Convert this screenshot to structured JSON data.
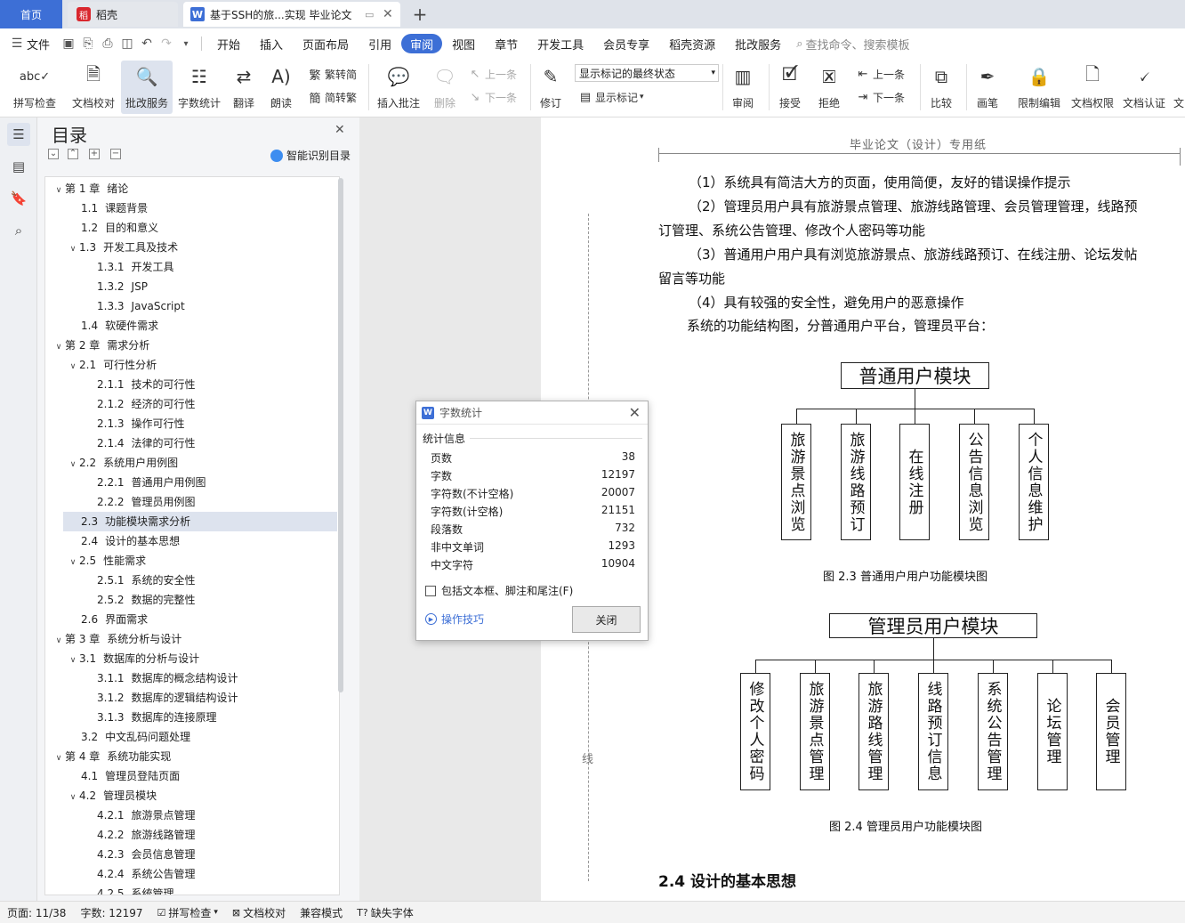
{
  "tabs": {
    "home": "首页",
    "daoke": "稻壳",
    "document": "基于SSH的旅...实现 毕业论文"
  },
  "menu": {
    "file": "文件",
    "items": [
      "开始",
      "插入",
      "页面布局",
      "引用",
      "审阅",
      "视图",
      "章节",
      "开发工具",
      "会员专享",
      "稻壳资源",
      "批改服务"
    ],
    "active_index": 4,
    "search_placeholder": "查找命令、搜索模板"
  },
  "ribbon": {
    "spellcheck": "拼写检查",
    "doc_proof": "文档校对",
    "review_service": "批改服务",
    "word_count": "字数统计",
    "translate": "翻译",
    "read_aloud": "朗读",
    "trad_to_simp": "繁转简",
    "simp_to_trad": "简转繁",
    "insert_comment": "插入批注",
    "delete": "删除",
    "prev_comment": "上一条",
    "next_comment": "下一条",
    "track_changes": "修订",
    "markup_state": "显示标记的最终状态",
    "show_markup": "显示标记",
    "review_pane": "审阅",
    "accept": "接受",
    "reject": "拒绝",
    "prev_change": "上一条",
    "next_change": "下一条",
    "compare": "比较",
    "pen": "画笔",
    "restrict_edit": "限制编辑",
    "doc_permission": "文档权限",
    "doc_certify": "文档认证",
    "more": "文"
  },
  "toc": {
    "title": "目录",
    "smart": "智能识别目录",
    "items": [
      {
        "num": "第 1 章",
        "text": "绪论",
        "level": 0,
        "caret": true
      },
      {
        "num": "1.1",
        "text": "课题背景",
        "level": 1
      },
      {
        "num": "1.2",
        "text": "目的和意义",
        "level": 1
      },
      {
        "num": "1.3",
        "text": "开发工具及技术",
        "level": 1,
        "caret": true
      },
      {
        "num": "1.3.1",
        "text": "开发工具",
        "level": 2
      },
      {
        "num": "1.3.2",
        "text": "JSP",
        "level": 2
      },
      {
        "num": "1.3.3",
        "text": "JavaScript",
        "level": 2
      },
      {
        "num": "1.4",
        "text": "软硬件需求",
        "level": 1
      },
      {
        "num": "第 2 章",
        "text": "需求分析",
        "level": 0,
        "caret": true
      },
      {
        "num": "2.1",
        "text": "可行性分析",
        "level": 1,
        "caret": true
      },
      {
        "num": "2.1.1",
        "text": "技术的可行性",
        "level": 2
      },
      {
        "num": "2.1.2",
        "text": "经济的可行性",
        "level": 2
      },
      {
        "num": "2.1.3",
        "text": "操作可行性",
        "level": 2
      },
      {
        "num": "2.1.4",
        "text": "法律的可行性",
        "level": 2
      },
      {
        "num": "2.2",
        "text": "系统用户用例图",
        "level": 1,
        "caret": true
      },
      {
        "num": "2.2.1",
        "text": "普通用户用例图",
        "level": 2
      },
      {
        "num": "2.2.2",
        "text": "管理员用例图",
        "level": 2
      },
      {
        "num": "2.3",
        "text": "功能模块需求分析",
        "level": 1,
        "selected": true
      },
      {
        "num": "2.4",
        "text": "设计的基本思想",
        "level": 1
      },
      {
        "num": "2.5",
        "text": "性能需求",
        "level": 1,
        "caret": true
      },
      {
        "num": "2.5.1",
        "text": "系统的安全性",
        "level": 2
      },
      {
        "num": "2.5.2",
        "text": "数据的完整性",
        "level": 2
      },
      {
        "num": "2.6",
        "text": "界面需求",
        "level": 1
      },
      {
        "num": "第 3 章",
        "text": "系统分析与设计",
        "level": 0,
        "caret": true
      },
      {
        "num": "3.1",
        "text": "数据库的分析与设计",
        "level": 1,
        "caret": true
      },
      {
        "num": "3.1.1",
        "text": "数据库的概念结构设计",
        "level": 2
      },
      {
        "num": "3.1.2",
        "text": "数据库的逻辑结构设计",
        "level": 2
      },
      {
        "num": "3.1.3",
        "text": "数据库的连接原理",
        "level": 2
      },
      {
        "num": "3.2",
        "text": "中文乱码问题处理",
        "level": 1
      },
      {
        "num": "第 4 章",
        "text": "系统功能实现",
        "level": 0,
        "caret": true
      },
      {
        "num": "4.1",
        "text": "管理员登陆页面",
        "level": 1
      },
      {
        "num": "4.2",
        "text": "管理员模块",
        "level": 1,
        "caret": true
      },
      {
        "num": "4.2.1",
        "text": "旅游景点管理",
        "level": 2
      },
      {
        "num": "4.2.2",
        "text": "旅游线路管理",
        "level": 2
      },
      {
        "num": "4.2.3",
        "text": "会员信息管理",
        "level": 2
      },
      {
        "num": "4.2.4",
        "text": "系统公告管理",
        "level": 2
      },
      {
        "num": "4.2.5",
        "text": "系统管理",
        "level": 2
      }
    ]
  },
  "document": {
    "header": "毕业论文（设计）专用纸",
    "binding_mark": "线",
    "paragraphs": [
      "（1）系统具有简洁大方的页面，使用简便，友好的错误操作提示",
      "（2）管理员用户具有旅游景点管理、旅游线路管理、会员管理管理，线路预",
      "订管理、系统公告管理、修改个人密码等功能",
      "（3）普通用户用户具有浏览旅游景点、旅游线路预订、在线注册、论坛发帖",
      "留言等功能",
      "（4）具有较强的安全性，避免用户的恶意操作",
      "系统的功能结构图，分普通用户平台，管理员平台："
    ],
    "diagram1": {
      "root": "普通用户模块",
      "children": [
        "旅游景点浏览",
        "旅游线路预订",
        "在线注册",
        "公告信息浏览",
        "个人信息维护"
      ],
      "caption": "图 2.3    普通用户用户功能模块图"
    },
    "diagram2": {
      "root": "管理员用户模块",
      "children": [
        "修改个人密码",
        "旅游景点管理",
        "旅游路线管理",
        "线路预订信息",
        "系统公告管理",
        "论坛管理",
        "会员管理"
      ],
      "caption": "图 2.4    管理员用户功能模块图"
    },
    "section_heading": "2.4  设计的基本思想"
  },
  "dialog": {
    "title": "字数统计",
    "subtitle": "统计信息",
    "rows": [
      {
        "label": "页数",
        "value": "38"
      },
      {
        "label": "字数",
        "value": "12197"
      },
      {
        "label": "字符数(不计空格)",
        "value": "20007"
      },
      {
        "label": "字符数(计空格)",
        "value": "21151"
      },
      {
        "label": "段落数",
        "value": "732"
      },
      {
        "label": "非中文单词",
        "value": "1293"
      },
      {
        "label": "中文字符",
        "value": "10904"
      }
    ],
    "checkbox": "包括文本框、脚注和尾注(F)",
    "tips": "操作技巧",
    "close": "关闭"
  },
  "status": {
    "page": "页面: 11/38",
    "words": "字数: 12197",
    "spell": "拼写检查",
    "proof": "文档校对",
    "compat": "兼容模式",
    "missing_font": "缺失字体"
  }
}
